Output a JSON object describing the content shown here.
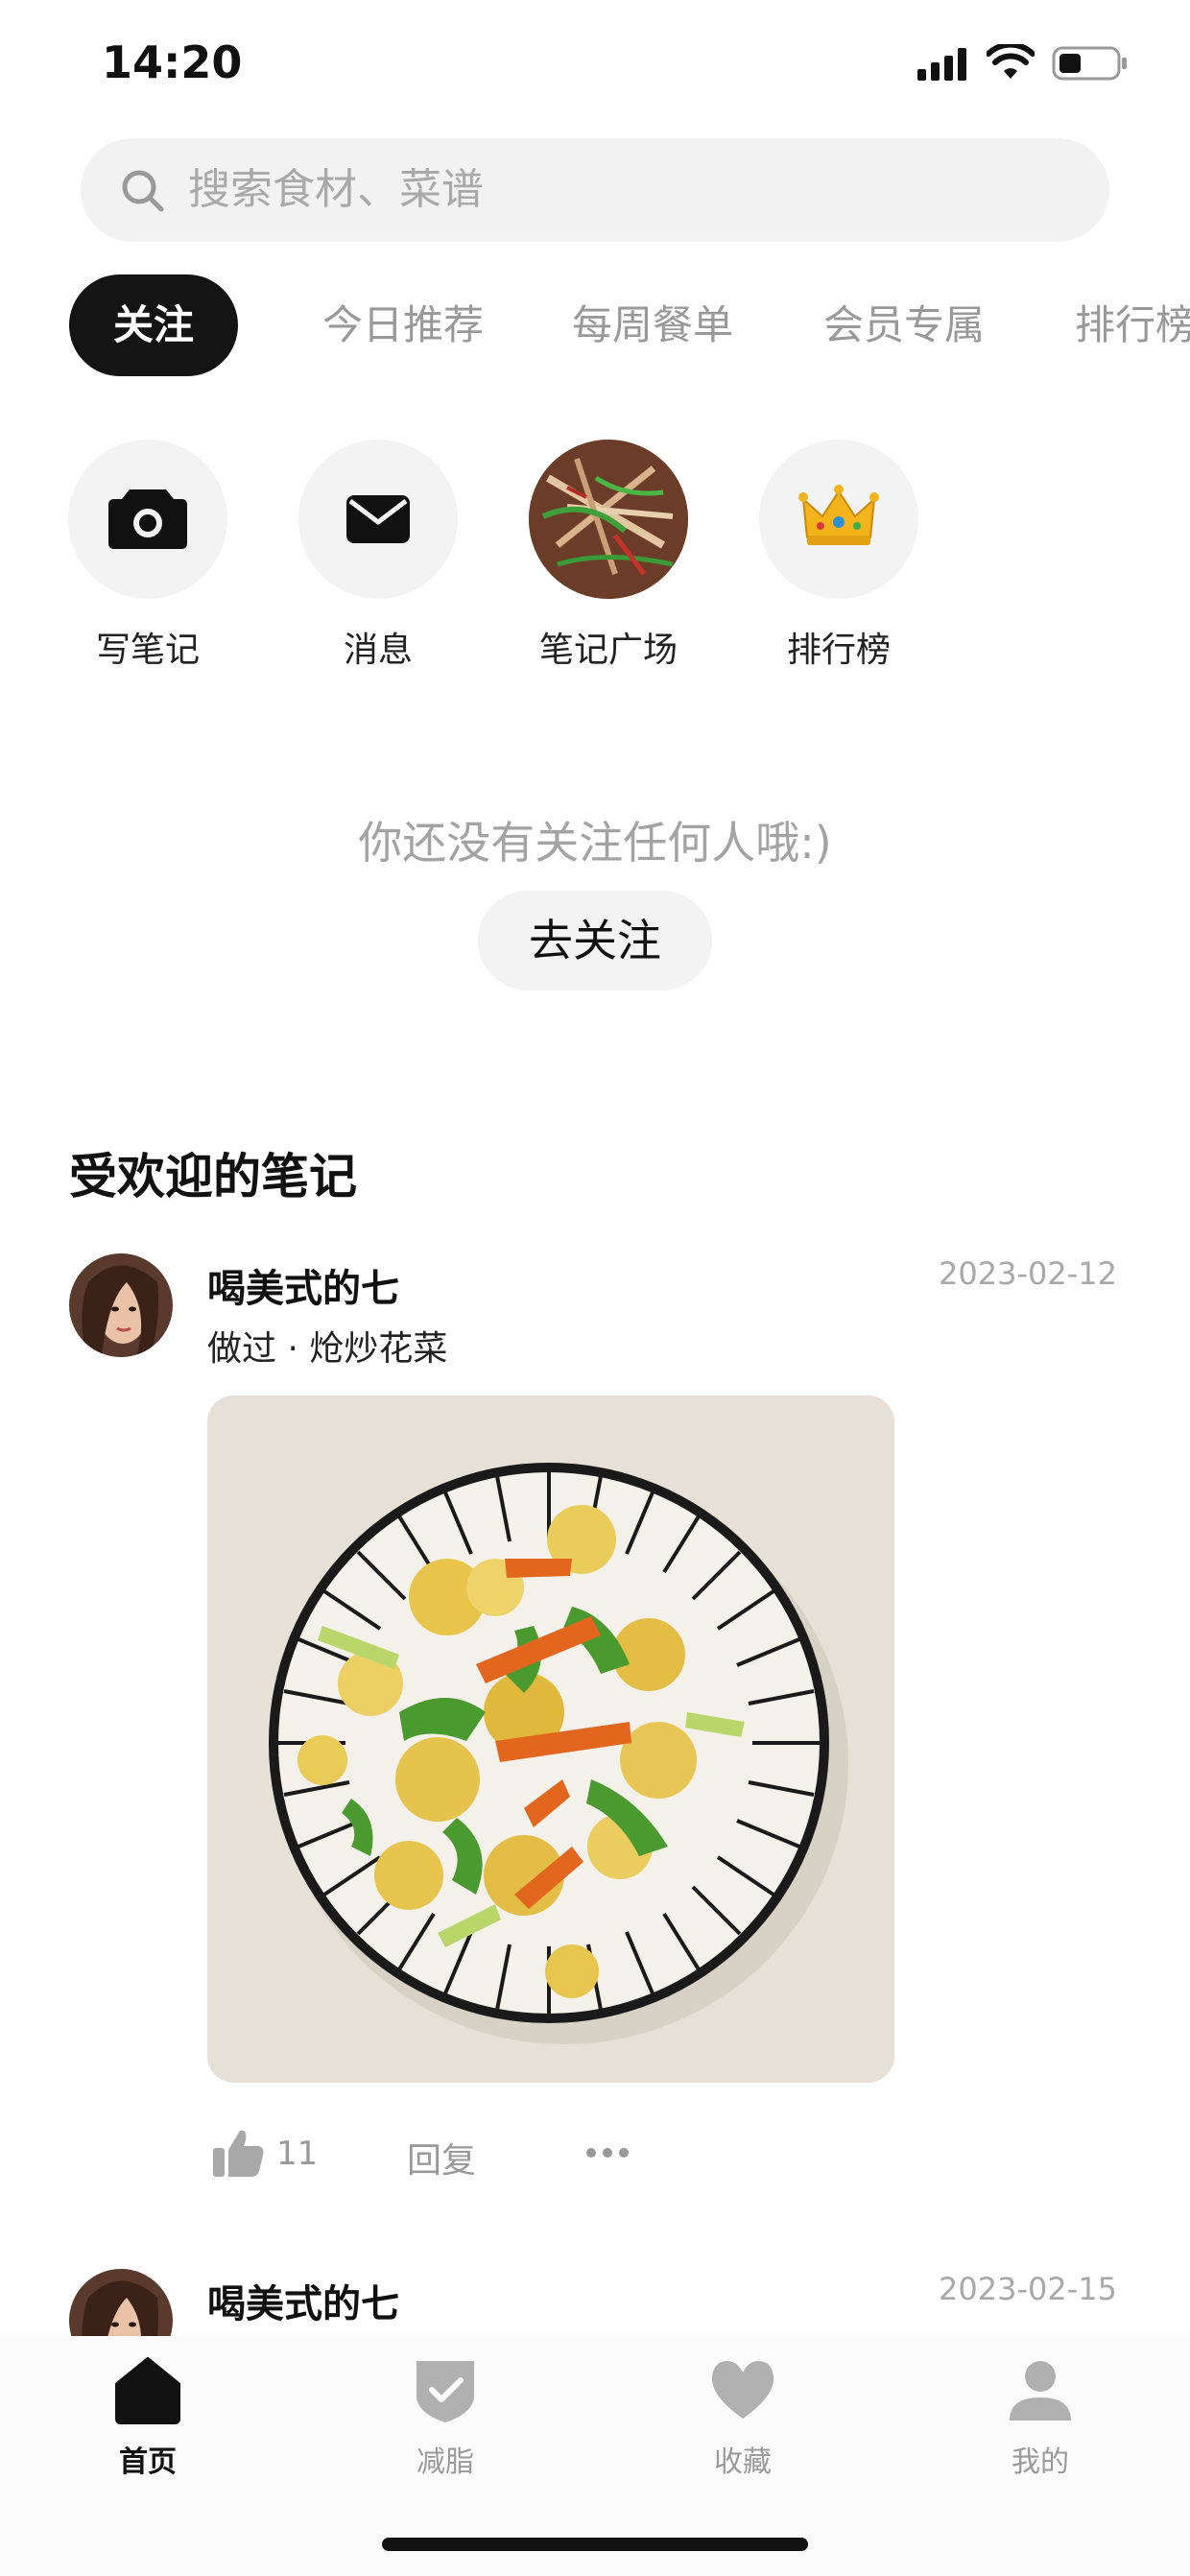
{
  "status_bar": {
    "time": "14:20"
  },
  "search": {
    "placeholder": "搜索食材、菜谱"
  },
  "tabs": [
    {
      "label": "关注",
      "active": true
    },
    {
      "label": "今日推荐"
    },
    {
      "label": "每周餐单"
    },
    {
      "label": "会员专属"
    },
    {
      "label": "排行榜"
    }
  ],
  "quick_actions": [
    {
      "label": "写笔记",
      "icon": "camera-icon"
    },
    {
      "label": "消息",
      "icon": "envelope-icon"
    },
    {
      "label": "笔记广场",
      "icon": "food-thumbnail"
    },
    {
      "label": "排行榜",
      "icon": "crown-icon"
    }
  ],
  "empty_state": {
    "text": "你还没有关注任何人哦:)",
    "button": "去关注"
  },
  "section": {
    "title": "受欢迎的笔记"
  },
  "posts": [
    {
      "author": "喝美式的七",
      "subtitle": "做过 · 炝炒花菜",
      "date": "2023-02-12",
      "likes": "11",
      "reply": "回复"
    },
    {
      "author": "喝美式的七",
      "date": "2023-02-15"
    }
  ],
  "tabbar": [
    {
      "label": "首页",
      "icon": "home-icon",
      "active": true
    },
    {
      "label": "减脂",
      "icon": "shield-check-icon"
    },
    {
      "label": "收藏",
      "icon": "heart-icon"
    },
    {
      "label": "我的",
      "icon": "user-icon"
    }
  ],
  "colors": {
    "accent": "#141414",
    "muted": "#999999",
    "chip_bg": "#f3f3f3"
  }
}
